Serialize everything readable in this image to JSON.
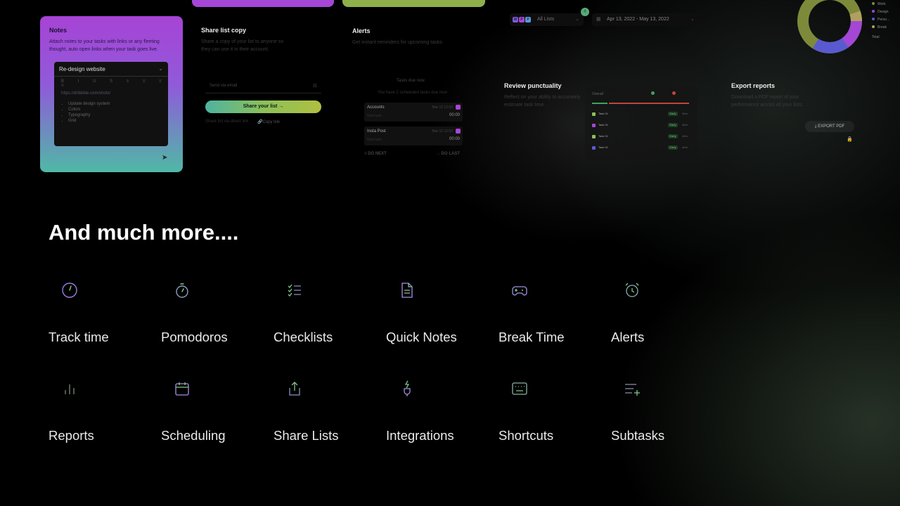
{
  "notes": {
    "title": "Notes",
    "description": "Attach notes to your tasks with links or any fleeting thought, auto open links when your task goes live.",
    "editor_title": "Re-design website",
    "toolbar_glyphs": "B I U S ≡ ≡ ≡ ≡",
    "link_text": "https://dribbble.com/shots/",
    "list_items": [
      "Update design system",
      "Colors",
      "Typography",
      "Grid"
    ]
  },
  "share": {
    "title": "Share list copy",
    "description": "Share a copy of your list to anyone so they can use it in their account.",
    "email_placeholder": "Send via email",
    "button_label": "Share your list",
    "footer_text": "Share list via direct link",
    "copy_link_label": "Copy link"
  },
  "alerts": {
    "title": "Alerts",
    "description": "Get instant reminders for upcoming tasks.",
    "subtitle": "Tasks due now",
    "count_text": "You have 2 scheduled tasks due now",
    "tasks": [
      {
        "name": "Accounts",
        "meta": "Mar 12 12:00",
        "sub": "Next task",
        "time": "00:00"
      },
      {
        "name": "Insta Post",
        "meta": "Mar 12 12:00",
        "sub": "Next task",
        "time": "00:00"
      }
    ],
    "do_next_label": "DO NEXT",
    "do_last_label": "DO LAST"
  },
  "filters": {
    "avatars": [
      "W",
      "P",
      "P"
    ],
    "list_label": "All Lists",
    "badge_count": "4",
    "date_range": "Apr 13, 2022 - May 13, 2022"
  },
  "donut_legend": [
    "Work",
    "Design",
    "Perso...",
    "Break"
  ],
  "donut_total_label": "Total",
  "review": {
    "title": "Review punctuality",
    "description": "Reflect on your ability to accurately estimate task time.",
    "chart_header": "Overall",
    "rows": [
      {
        "name": "Task 01",
        "tag": "Early",
        "num": "40m"
      },
      {
        "name": "Task 01",
        "tag": "Early",
        "num": "40m"
      },
      {
        "name": "Task 01",
        "tag": "Early",
        "num": "40m"
      },
      {
        "name": "Task 01",
        "tag": "Early",
        "num": "40m"
      }
    ]
  },
  "export": {
    "title": "Export reports",
    "description": "Download a PDF report of your performance across all your lists.",
    "button_label": "EXPORT PDF"
  },
  "headline": "And much more....",
  "features": [
    {
      "label": "Track time",
      "icon": "clock-icon"
    },
    {
      "label": "Pomodoros",
      "icon": "stopwatch-icon"
    },
    {
      "label": "Checklists",
      "icon": "checklist-icon"
    },
    {
      "label": "Quick Notes",
      "icon": "document-icon"
    },
    {
      "label": "Break Time",
      "icon": "gamepad-icon"
    },
    {
      "label": "Alerts",
      "icon": "alarm-clock-icon"
    },
    {
      "label": "Reports",
      "icon": "bar-chart-icon"
    },
    {
      "label": "Scheduling",
      "icon": "calendar-icon"
    },
    {
      "label": "Share Lists",
      "icon": "share-icon"
    },
    {
      "label": "Integrations",
      "icon": "plug-icon"
    },
    {
      "label": "Shortcuts",
      "icon": "keyboard-icon"
    },
    {
      "label": "Subtasks",
      "icon": "list-add-icon"
    }
  ],
  "colors": {
    "purple": "#a446d6",
    "green": "#8cc05a",
    "teal": "#4eb3a0",
    "red": "#c0453e"
  }
}
